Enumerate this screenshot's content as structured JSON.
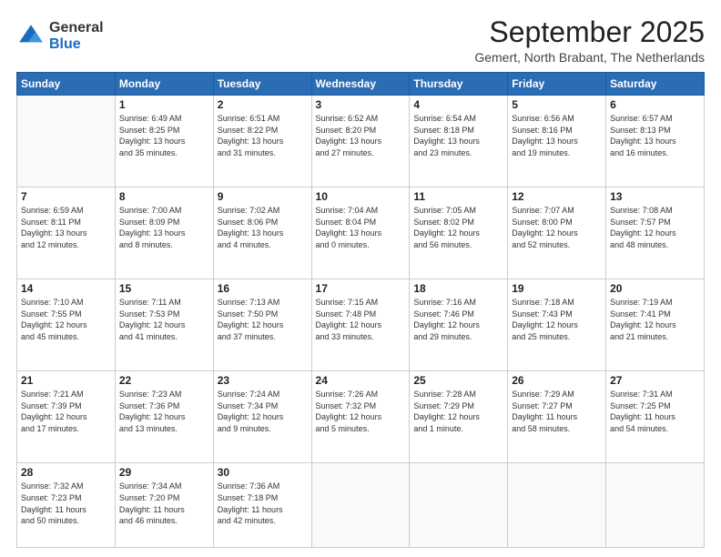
{
  "logo": {
    "general": "General",
    "blue": "Blue"
  },
  "title": "September 2025",
  "subtitle": "Gemert, North Brabant, The Netherlands",
  "headers": [
    "Sunday",
    "Monday",
    "Tuesday",
    "Wednesday",
    "Thursday",
    "Friday",
    "Saturday"
  ],
  "weeks": [
    [
      {
        "day": "",
        "info": ""
      },
      {
        "day": "1",
        "info": "Sunrise: 6:49 AM\nSunset: 8:25 PM\nDaylight: 13 hours\nand 35 minutes."
      },
      {
        "day": "2",
        "info": "Sunrise: 6:51 AM\nSunset: 8:22 PM\nDaylight: 13 hours\nand 31 minutes."
      },
      {
        "day": "3",
        "info": "Sunrise: 6:52 AM\nSunset: 8:20 PM\nDaylight: 13 hours\nand 27 minutes."
      },
      {
        "day": "4",
        "info": "Sunrise: 6:54 AM\nSunset: 8:18 PM\nDaylight: 13 hours\nand 23 minutes."
      },
      {
        "day": "5",
        "info": "Sunrise: 6:56 AM\nSunset: 8:16 PM\nDaylight: 13 hours\nand 19 minutes."
      },
      {
        "day": "6",
        "info": "Sunrise: 6:57 AM\nSunset: 8:13 PM\nDaylight: 13 hours\nand 16 minutes."
      }
    ],
    [
      {
        "day": "7",
        "info": "Sunrise: 6:59 AM\nSunset: 8:11 PM\nDaylight: 13 hours\nand 12 minutes."
      },
      {
        "day": "8",
        "info": "Sunrise: 7:00 AM\nSunset: 8:09 PM\nDaylight: 13 hours\nand 8 minutes."
      },
      {
        "day": "9",
        "info": "Sunrise: 7:02 AM\nSunset: 8:06 PM\nDaylight: 13 hours\nand 4 minutes."
      },
      {
        "day": "10",
        "info": "Sunrise: 7:04 AM\nSunset: 8:04 PM\nDaylight: 13 hours\nand 0 minutes."
      },
      {
        "day": "11",
        "info": "Sunrise: 7:05 AM\nSunset: 8:02 PM\nDaylight: 12 hours\nand 56 minutes."
      },
      {
        "day": "12",
        "info": "Sunrise: 7:07 AM\nSunset: 8:00 PM\nDaylight: 12 hours\nand 52 minutes."
      },
      {
        "day": "13",
        "info": "Sunrise: 7:08 AM\nSunset: 7:57 PM\nDaylight: 12 hours\nand 48 minutes."
      }
    ],
    [
      {
        "day": "14",
        "info": "Sunrise: 7:10 AM\nSunset: 7:55 PM\nDaylight: 12 hours\nand 45 minutes."
      },
      {
        "day": "15",
        "info": "Sunrise: 7:11 AM\nSunset: 7:53 PM\nDaylight: 12 hours\nand 41 minutes."
      },
      {
        "day": "16",
        "info": "Sunrise: 7:13 AM\nSunset: 7:50 PM\nDaylight: 12 hours\nand 37 minutes."
      },
      {
        "day": "17",
        "info": "Sunrise: 7:15 AM\nSunset: 7:48 PM\nDaylight: 12 hours\nand 33 minutes."
      },
      {
        "day": "18",
        "info": "Sunrise: 7:16 AM\nSunset: 7:46 PM\nDaylight: 12 hours\nand 29 minutes."
      },
      {
        "day": "19",
        "info": "Sunrise: 7:18 AM\nSunset: 7:43 PM\nDaylight: 12 hours\nand 25 minutes."
      },
      {
        "day": "20",
        "info": "Sunrise: 7:19 AM\nSunset: 7:41 PM\nDaylight: 12 hours\nand 21 minutes."
      }
    ],
    [
      {
        "day": "21",
        "info": "Sunrise: 7:21 AM\nSunset: 7:39 PM\nDaylight: 12 hours\nand 17 minutes."
      },
      {
        "day": "22",
        "info": "Sunrise: 7:23 AM\nSunset: 7:36 PM\nDaylight: 12 hours\nand 13 minutes."
      },
      {
        "day": "23",
        "info": "Sunrise: 7:24 AM\nSunset: 7:34 PM\nDaylight: 12 hours\nand 9 minutes."
      },
      {
        "day": "24",
        "info": "Sunrise: 7:26 AM\nSunset: 7:32 PM\nDaylight: 12 hours\nand 5 minutes."
      },
      {
        "day": "25",
        "info": "Sunrise: 7:28 AM\nSunset: 7:29 PM\nDaylight: 12 hours\nand 1 minute."
      },
      {
        "day": "26",
        "info": "Sunrise: 7:29 AM\nSunset: 7:27 PM\nDaylight: 11 hours\nand 58 minutes."
      },
      {
        "day": "27",
        "info": "Sunrise: 7:31 AM\nSunset: 7:25 PM\nDaylight: 11 hours\nand 54 minutes."
      }
    ],
    [
      {
        "day": "28",
        "info": "Sunrise: 7:32 AM\nSunset: 7:23 PM\nDaylight: 11 hours\nand 50 minutes."
      },
      {
        "day": "29",
        "info": "Sunrise: 7:34 AM\nSunset: 7:20 PM\nDaylight: 11 hours\nand 46 minutes."
      },
      {
        "day": "30",
        "info": "Sunrise: 7:36 AM\nSunset: 7:18 PM\nDaylight: 11 hours\nand 42 minutes."
      },
      {
        "day": "",
        "info": ""
      },
      {
        "day": "",
        "info": ""
      },
      {
        "day": "",
        "info": ""
      },
      {
        "day": "",
        "info": ""
      }
    ]
  ]
}
